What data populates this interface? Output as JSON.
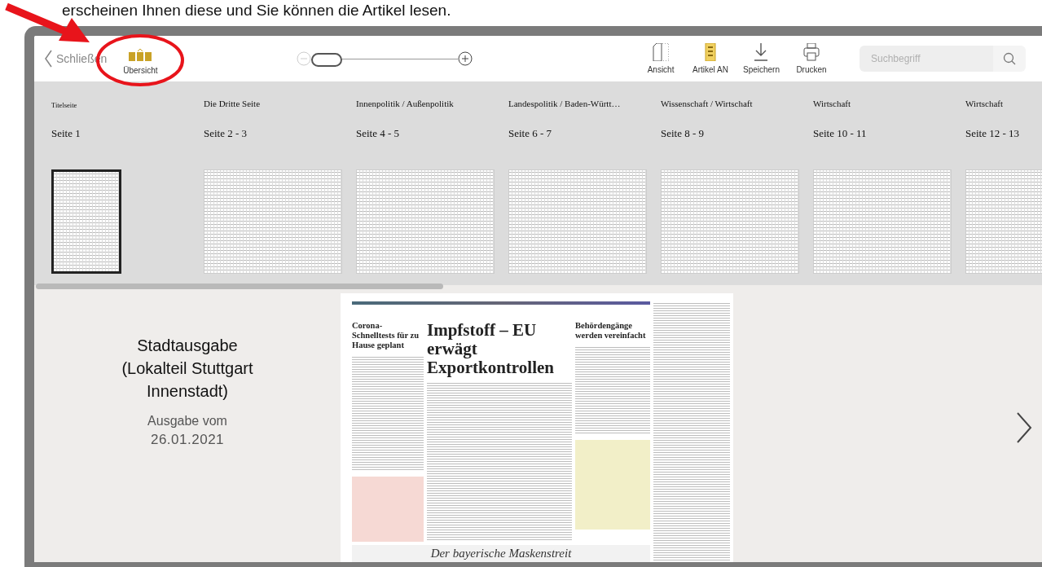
{
  "document_text": "erscheinen Ihnen diese und Sie können die Artikel lesen.",
  "toolbar": {
    "back_label": "Schließen",
    "overview_label": "Übersicht",
    "zoom": {
      "level": 0.0
    },
    "actions": [
      {
        "label": "Ansicht",
        "kind": "view",
        "on": false
      },
      {
        "label": "Artikel AN",
        "kind": "article",
        "on": true
      },
      {
        "label": "Speichern",
        "kind": "save",
        "on": false
      },
      {
        "label": "Drucken",
        "kind": "print",
        "on": false
      }
    ],
    "search": {
      "placeholder": "Suchbegriff"
    }
  },
  "sections": [
    {
      "title": "Titelseite",
      "pages": "Seite 1",
      "kind": "single",
      "selected": true
    },
    {
      "title": "Die Dritte Seite",
      "pages": "Seite 2 - 3",
      "kind": "spread",
      "selected": false
    },
    {
      "title": "Innenpolitik / Außenpolitik",
      "pages": "Seite 4 - 5",
      "kind": "spread",
      "selected": false
    },
    {
      "title": "Landespolitik / Baden-Württ…",
      "pages": "Seite 6 - 7",
      "kind": "spread",
      "selected": false
    },
    {
      "title": "Wissenschaft / Wirtschaft",
      "pages": "Seite 8 - 9",
      "kind": "spread",
      "selected": false
    },
    {
      "title": "Wirtschaft",
      "pages": "Seite 10 - 11",
      "kind": "spread",
      "selected": false
    },
    {
      "title": "Wirtschaft",
      "pages": "Seite 12 - 13",
      "kind": "spread",
      "selected": false
    }
  ],
  "cover": {
    "edition": "Stadtausgabe (Lokalteil Stuttgart Innenstadt)",
    "date_label": "Ausgabe vom",
    "date": "26.01.2021"
  },
  "newspaper": {
    "left_headline": "Corona-Schnelltests für zu Hause geplant",
    "main_headline": "Impfstoff – EU erwägt Exportkontrollen",
    "right_headline": "Behördengänge werden vereinfacht",
    "bottom_headline": "Der bayerische Maskenstreit"
  }
}
